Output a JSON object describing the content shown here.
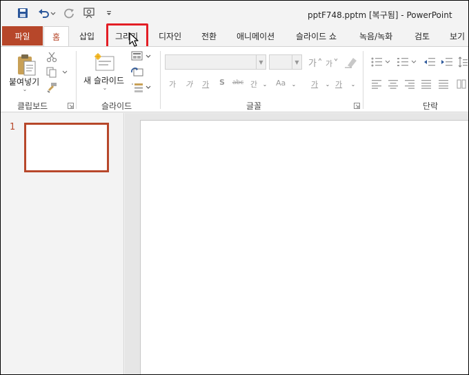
{
  "title_bar": {
    "document_title": "pptF748.pptm [복구됨]  -  PowerPoint",
    "quick_access": [
      "save-icon",
      "undo-icon",
      "redo-icon",
      "present-icon",
      "customize-icon"
    ]
  },
  "tabs": {
    "file": "파일",
    "home": "홈",
    "insert": "삽입",
    "draw": "그리기",
    "design": "디자인",
    "transitions": "전환",
    "animations": "애니메이션",
    "slideshow": "슬라이드 쇼",
    "record": "녹음/녹화",
    "review": "검토",
    "view": "보기"
  },
  "ribbon": {
    "clipboard": {
      "paste_label": "붙여넣기",
      "group_label": "클립보드"
    },
    "slides": {
      "new_slide_label": "새 슬라이드",
      "group_label": "슬라이드"
    },
    "font": {
      "group_label": "글꼴",
      "glyphs": [
        "가",
        "가",
        "가",
        "S",
        "abc",
        "간",
        "Aa",
        "가"
      ]
    },
    "paragraph": {
      "group_label": "단락"
    }
  },
  "thumbnails": {
    "slide_number": "1"
  },
  "colors": {
    "accent": "#b7472a",
    "highlight": "#e31e25"
  }
}
